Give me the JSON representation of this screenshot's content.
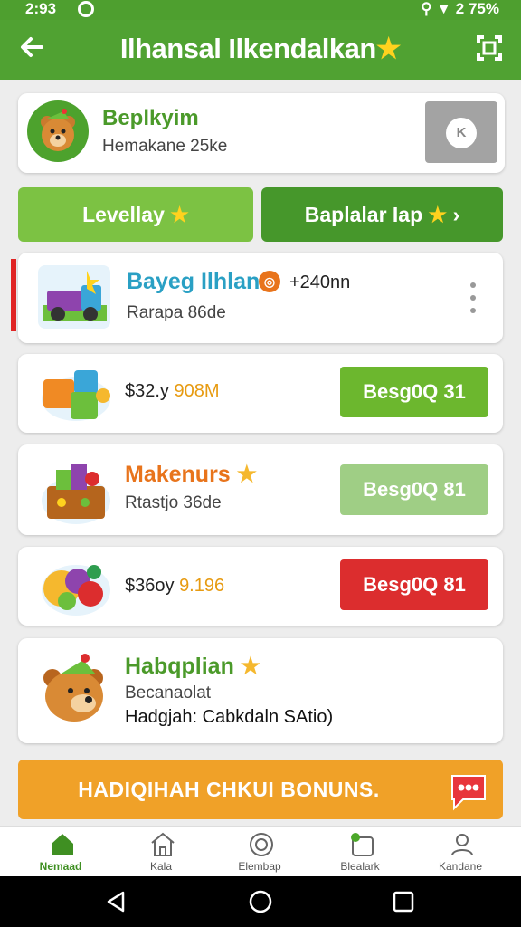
{
  "status_bar": {
    "time": "2:93",
    "right": "⚲ ▼ 2 75%",
    "icons": [
      "whatsapp-icon",
      "location-icon",
      "wifi-icon",
      "battery-icon"
    ]
  },
  "app_bar": {
    "title": "Ilhansal Ilkendalkan",
    "title_star": "★"
  },
  "profile": {
    "name": "Beplkyim",
    "subtitle": "Hemakane 25ke",
    "action_icon_text": "K"
  },
  "tabs": [
    {
      "label": "Levellay",
      "star": "★"
    },
    {
      "label": "Baplalar Iap",
      "star": "★",
      "chevron": "›"
    }
  ],
  "list": [
    {
      "title": "Bayeg Ilhlan",
      "badge": "+240nn",
      "subtitle": "Rarapa 86de",
      "title_color": "#2aa0c4"
    },
    {
      "price": "$32.y",
      "price_accent": "908M",
      "button": "Besg0Q 31",
      "button_color": "#6cb72e"
    },
    {
      "title": "Makenurs",
      "title_star": "★",
      "subtitle": "Rtastjo 36de",
      "button": "Besg0Q 81",
      "title_color": "#e8741c",
      "button_color": "#9fce85"
    },
    {
      "price": "$36oy",
      "price_accent": "9.196",
      "button": "Besg0Q 81",
      "button_color": "#dc2d2e"
    },
    {
      "title": "Habqplian",
      "title_star": "★",
      "subtitle": "Becanaolat",
      "line3": "Hadgjah: Cabkdaln SAtio)",
      "title_color": "#4b9a2a"
    }
  ],
  "bonus": {
    "label": "HADIQIHAH CHKUI BONUNS."
  },
  "bottom_nav": [
    {
      "label": "Nemaad",
      "icon": "home-icon",
      "active": true
    },
    {
      "label": "Kala",
      "icon": "store-icon",
      "active": false
    },
    {
      "label": "Elembap",
      "icon": "rewards-icon",
      "active": false
    },
    {
      "label": "Blealark",
      "icon": "gift-icon",
      "active": false
    },
    {
      "label": "Kandane",
      "icon": "profile-icon",
      "active": false
    }
  ],
  "colors": {
    "primary": "#50a232",
    "accent_yellow": "#ffd21e",
    "danger": "#dc2d2e",
    "bonus": "#f0a128"
  }
}
